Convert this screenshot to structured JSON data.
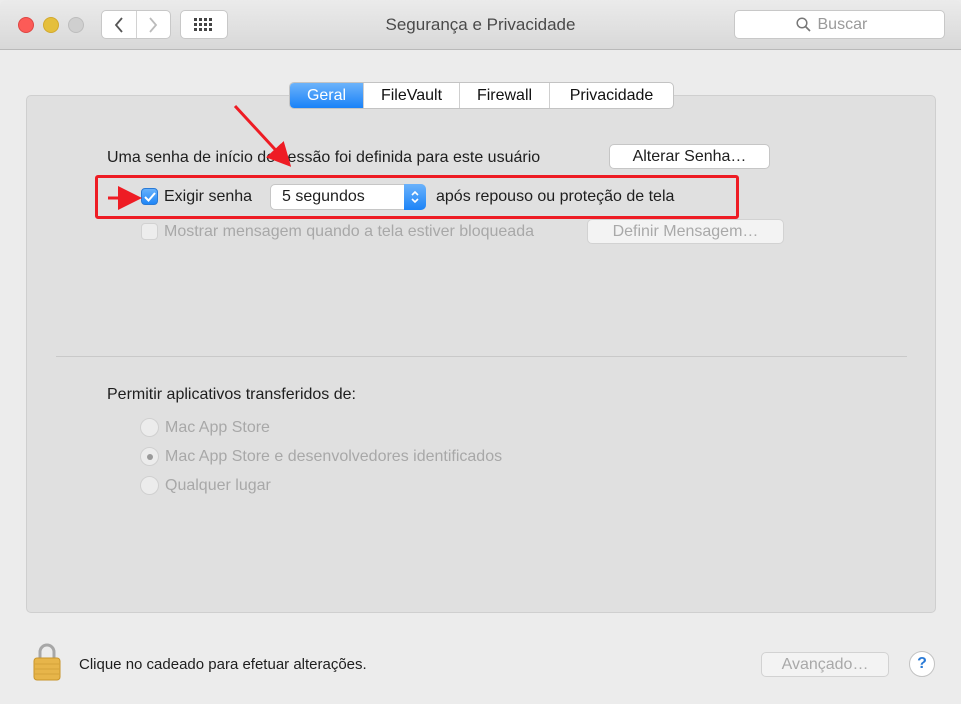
{
  "window": {
    "title": "Segurança e Privacidade",
    "search_placeholder": "Buscar"
  },
  "tabs": [
    {
      "label": "Geral",
      "active": true
    },
    {
      "label": "FileVault",
      "active": false
    },
    {
      "label": "Firewall",
      "active": false
    },
    {
      "label": "Privacidade",
      "active": false
    }
  ],
  "general": {
    "password_text": "Uma senha de início de sessão foi definida para este usuário",
    "change_password_button": "Alterar Senha…",
    "require_password": {
      "label": "Exigir senha",
      "checked": true
    },
    "delay_select": {
      "value": "5 segundos"
    },
    "after_text": "após repouso ou proteção de tela",
    "show_message": {
      "label": "Mostrar mensagem quando a tela estiver bloqueada",
      "checked": false,
      "enabled": false
    },
    "set_message_button": "Definir Mensagem…"
  },
  "apps": {
    "heading": "Permitir aplicativos transferidos de:",
    "options": [
      {
        "label": "Mac App Store",
        "selected": false
      },
      {
        "label": "Mac App Store e desenvolvedores identificados",
        "selected": true
      },
      {
        "label": "Qualquer lugar",
        "selected": false
      }
    ]
  },
  "footer": {
    "lock_text": "Clique no cadeado para efetuar alterações.",
    "advanced_button": "Avançado…",
    "help_label": "?"
  },
  "colors": {
    "accent": "#1a82f8",
    "highlight": "#ee1c24"
  }
}
